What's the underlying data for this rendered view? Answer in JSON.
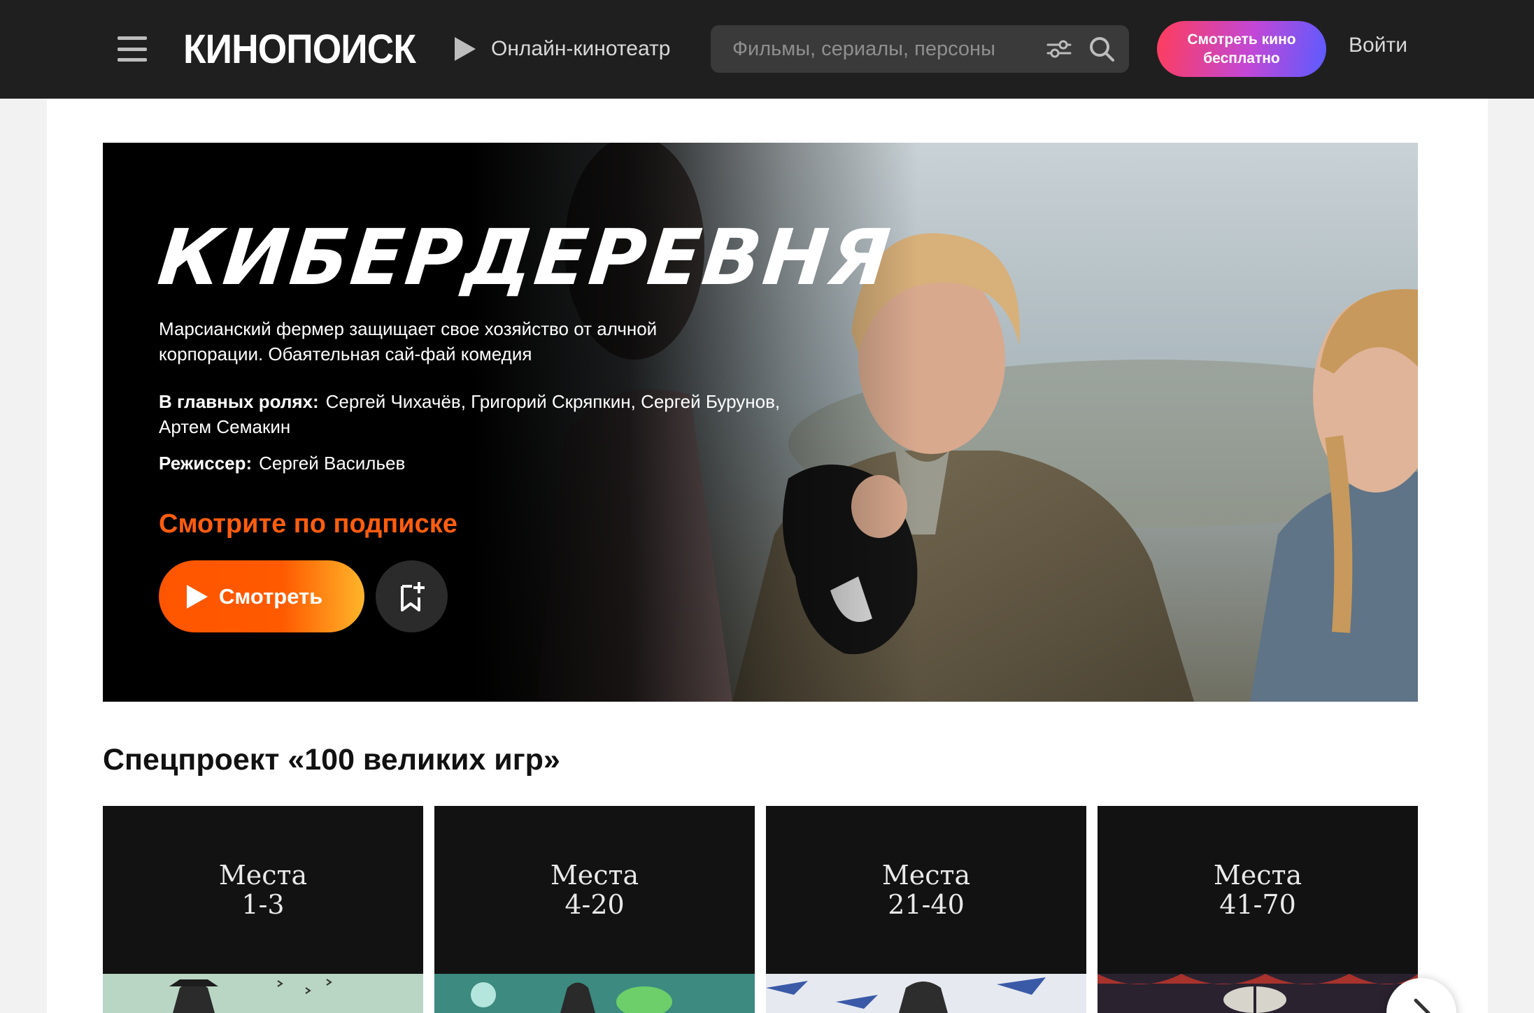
{
  "header": {
    "logo_text": "КИНОПОИСК",
    "online_label": "Онлайн-кинотеатр",
    "search_placeholder": "Фильмы, сериалы, персоны",
    "cta_line1": "Смотреть кино",
    "cta_line2": "бесплатно",
    "login_label": "Войти"
  },
  "hero": {
    "title": "КИБЕРДЕРЕВНЯ",
    "description": "Марсианский фермер защищает свое хозяйство от алчной корпорации. Обаятельная сай-фай комедия",
    "cast_label": "В главных ролях:",
    "cast": "Сергей Чихачёв, Григорий Скряпкин, Сергей Бурунов, Артем Семакин",
    "director_label": "Режиссер:",
    "director": "Сергей Васильев",
    "subscription_text": "Смотрите по подписке",
    "watch_label": "Смотреть"
  },
  "section": {
    "title": "Спецпроект «100 великих игр»",
    "cards": [
      {
        "line1": "Места",
        "line2": "1-3"
      },
      {
        "line1": "Места",
        "line2": "4-20"
      },
      {
        "line1": "Места",
        "line2": "21-40"
      },
      {
        "line1": "Места",
        "line2": "41-70"
      }
    ]
  },
  "colors": {
    "header_bg": "#1f1f1f",
    "accent_orange": "#ff5500",
    "cta_gradient": [
      "#ff3d5a",
      "#c247d6",
      "#5a5cff"
    ]
  },
  "icons": [
    "menu-icon",
    "play-icon",
    "filter-icon",
    "search-icon",
    "bookmark-add-icon",
    "chevron-right-icon"
  ]
}
